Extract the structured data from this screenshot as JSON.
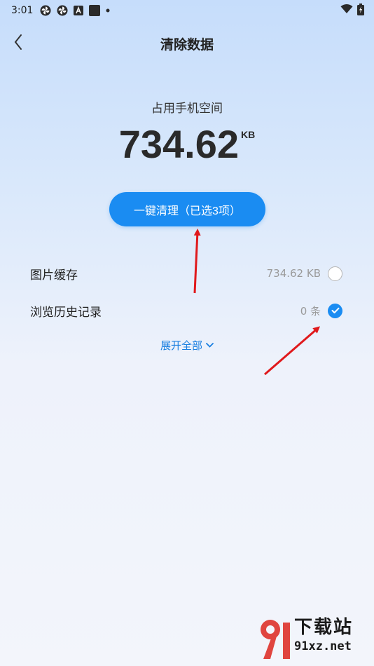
{
  "status_bar": {
    "time": "3:01",
    "icons": [
      "fan-icon",
      "fan-icon",
      "a-icon",
      "square-icon",
      "dot-icon"
    ],
    "right_icons": [
      "wifi-icon",
      "battery-icon"
    ]
  },
  "header": {
    "title": "清除数据",
    "back_icon": "chevron-left-icon"
  },
  "storage": {
    "subtitle": "占用手机空间",
    "value": "734.62",
    "unit": "KB"
  },
  "clean_button": {
    "label": "一键清理（已选3项）"
  },
  "items": [
    {
      "label": "图片缓存",
      "value": "734.62 KB",
      "checked": false
    },
    {
      "label": "浏览历史记录",
      "value": "0 条",
      "checked": true
    }
  ],
  "expand": {
    "label": "展开全部",
    "icon": "chevron-down-icon"
  },
  "watermark": {
    "text": "下载站",
    "url": "91xz.net"
  },
  "colors": {
    "accent": "#1a8cf2",
    "annotation_arrow": "#e0191c",
    "link": "#1a7fe0"
  }
}
